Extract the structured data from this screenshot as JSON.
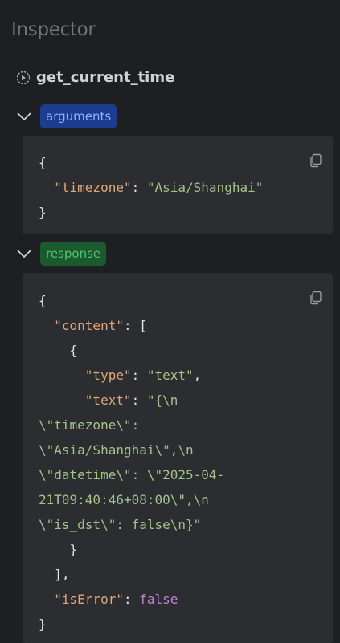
{
  "panel": {
    "title": "Inspector"
  },
  "tool": {
    "name": "get_current_time",
    "icon": "play-circle-icon"
  },
  "arguments": {
    "badge": "arguments",
    "timezone_key": "\"timezone\"",
    "timezone_value": "\"Asia/Shanghai\""
  },
  "response": {
    "badge": "response",
    "content_key": "\"content\"",
    "type_key": "\"type\"",
    "type_value": "\"text\"",
    "text_key": "\"text\"",
    "text_value_lines": [
      "\"{\\n",
      "\\\"timezone\\\":",
      "\\\"Asia/Shanghai\\\",\\n",
      "\\\"datetime\\\": \\\"2025-04-",
      "21T09:40:46+08:00\\\",\\n",
      "\\\"is_dst\\\": false\\n}\""
    ],
    "is_error_key": "\"isError\"",
    "is_error_value": "false"
  },
  "colors": {
    "background": "#1e1f22",
    "code_bg": "#2b2d30",
    "key": "#e0a87a",
    "string": "#a5c28a",
    "boolean": "#c77dde",
    "args_badge_bg": "#1b3c8f",
    "resp_badge_bg": "#1b5a2e"
  }
}
